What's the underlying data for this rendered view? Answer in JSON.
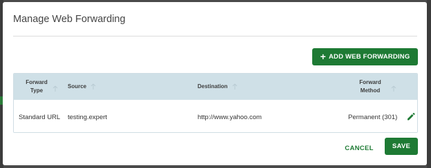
{
  "modal": {
    "title": "Manage Web Forwarding",
    "add_button_label": "ADD WEB FORWARDING",
    "add_button_icon": "plus-icon",
    "cancel_label": "CANCEL",
    "save_label": "SAVE",
    "accent_color": "#1e7a34",
    "header_bg": "#cfe0e7"
  },
  "table": {
    "columns": [
      {
        "line1": "Forward",
        "line2": "Type"
      },
      {
        "label": "Source"
      },
      {
        "label": "Destination"
      },
      {
        "line1": "Forward",
        "line2": "Method"
      }
    ],
    "rows": [
      {
        "type": "Standard URL",
        "source": "testing.expert",
        "destination": "http://www.yahoo.com",
        "method": "Permanent (301)",
        "action_icon": "pencil-edit-icon"
      }
    ]
  }
}
